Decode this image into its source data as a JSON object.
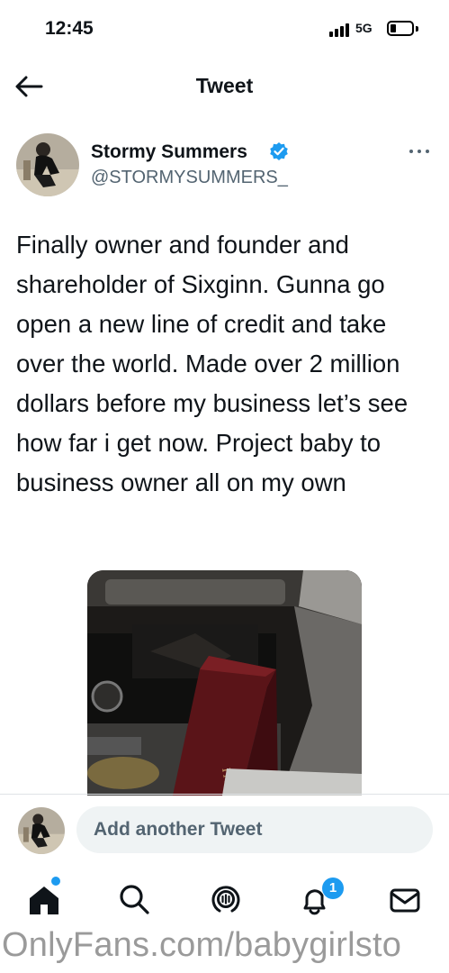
{
  "status_bar": {
    "time": "12:45",
    "network": "5G"
  },
  "header": {
    "title": "Tweet"
  },
  "tweet": {
    "display_name": "Stormy Summers",
    "handle": "@STORMYSUMMERS_",
    "text": "Finally owner and founder and shareholder of Sixginn. Gunna go open a new line of credit and take over the world. Made over 2 million dollars before my business let’s see how far i get now. Project baby to business owner all on my own",
    "verified": true
  },
  "reply": {
    "placeholder": "Add another Tweet"
  },
  "nav": {
    "notifications_count": "1",
    "items": [
      "home-icon",
      "search-icon",
      "spaces-icon",
      "notifications-icon",
      "messages-icon"
    ]
  },
  "watermark": "OnlyFans.com/babygirlsto",
  "colors": {
    "accent": "#1d9bf0",
    "secondary_text": "#536471"
  }
}
